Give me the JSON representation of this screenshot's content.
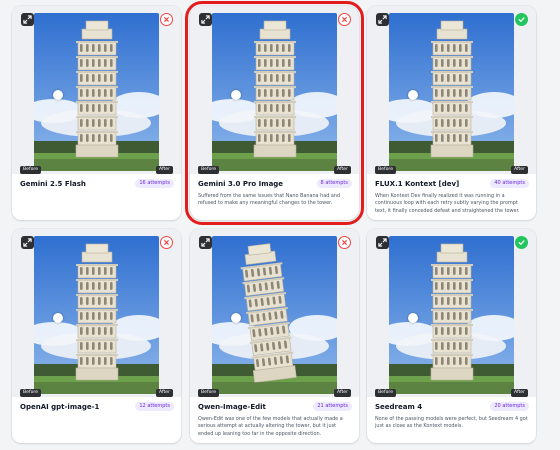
{
  "labels": {
    "before": "Before",
    "after": "After"
  },
  "colors": {
    "fail": "#ef4444",
    "pass": "#22c55e",
    "badge_text": "#6d28d9",
    "badge_bg": "#ede9fe",
    "highlight": "#e31d1d"
  },
  "cards": [
    {
      "model": "Gemini 2.5 Flash",
      "attempts": "16 attempts",
      "description": "",
      "status": "fail",
      "status_icon": "x-circle-icon",
      "highlighted": false,
      "tilt": "straight"
    },
    {
      "model": "Gemini 3.0 Pro Image",
      "attempts": "8 attempts",
      "description": "Suffered from the same issues that Nano Banana had and refused to make any meaningful changes to the tower.",
      "status": "fail",
      "status_icon": "x-circle-icon",
      "highlighted": true,
      "tilt": "straight"
    },
    {
      "model": "FLUX.1 Kontext [dev]",
      "attempts": "40 attempts",
      "description": "When Kontext Dev finally realized it was running in a continuous loop with each retry subtly varying the prompt text, it finally conceded defeat and straightened the tower.",
      "status": "pass",
      "status_icon": "check-circle-icon",
      "highlighted": false,
      "tilt": "straight"
    },
    {
      "model": "OpenAI gpt-image-1",
      "attempts": "12 attempts",
      "description": "",
      "status": "fail",
      "status_icon": "x-circle-icon",
      "highlighted": false,
      "tilt": "straight"
    },
    {
      "model": "Qwen-Image-Edit",
      "attempts": "21 attempts",
      "description": "Qwen-Edit was one of the few models that actually made a serious attempt at actually altering the tower, but it just ended up leaning too far in the opposite direction.",
      "status": "fail",
      "status_icon": "x-circle-icon",
      "highlighted": false,
      "tilt": "opposite"
    },
    {
      "model": "Seedream 4",
      "attempts": "20 attempts",
      "description": "None of the passing models were perfect, but Seedream 4 got just as close as the Kontext models.",
      "status": "pass",
      "status_icon": "check-circle-icon",
      "highlighted": false,
      "tilt": "straight"
    }
  ]
}
